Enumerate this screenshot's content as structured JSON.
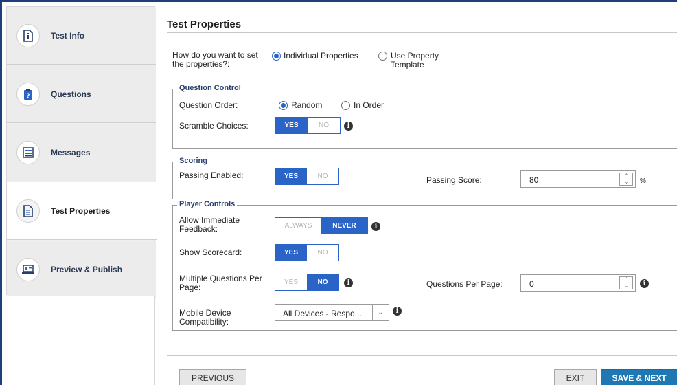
{
  "sidebar": {
    "items": [
      {
        "label": "Test Info",
        "icon": "document-info-icon"
      },
      {
        "label": "Questions",
        "icon": "clipboard-question-icon"
      },
      {
        "label": "Messages",
        "icon": "message-list-icon"
      },
      {
        "label": "Test Properties",
        "icon": "properties-list-icon"
      },
      {
        "label": "Preview & Publish",
        "icon": "laptop-preview-icon"
      }
    ],
    "active_index": 3
  },
  "main": {
    "title": "Test Properties",
    "set_properties": {
      "label_line1": "How do you want to set",
      "label_line2": "the properties?:",
      "options": [
        "Individual Properties",
        "Use Property",
        "Template"
      ],
      "selected": "Individual Properties"
    },
    "question_control": {
      "legend": "Question Control",
      "question_order_label": "Question Order:",
      "order_options": [
        "Random",
        "In Order"
      ],
      "order_selected": "Random",
      "scramble_label": "Scramble Choices:",
      "scramble_yes": "YES",
      "scramble_no": "NO",
      "scramble_value": "YES"
    },
    "scoring": {
      "legend": "Scoring",
      "passing_enabled_label": "Passing Enabled:",
      "yes": "YES",
      "no": "NO",
      "passing_enabled_value": "YES",
      "passing_score_label": "Passing Score:",
      "passing_score_value": "80",
      "passing_score_unit": "%"
    },
    "player_controls": {
      "legend": "Player Controls",
      "feedback_label_line1": "Allow Immediate",
      "feedback_label_line2": "Feedback:",
      "feedback_always": "ALWAYS",
      "feedback_never": "NEVER",
      "feedback_value": "NEVER",
      "scorecard_label": "Show Scorecard:",
      "scorecard_yes": "YES",
      "scorecard_no": "NO",
      "scorecard_value": "YES",
      "multi_label_line1": "Multiple Questions Per",
      "multi_label_line2": "Page:",
      "multi_yes": "YES",
      "multi_no": "NO",
      "multi_value": "NO",
      "qpp_label": "Questions Per Page:",
      "qpp_value": "0",
      "mobile_label_line1": "Mobile Device",
      "mobile_label_line2": "Compatibility:",
      "mobile_value": "All Devices - Respo..."
    }
  },
  "footer": {
    "previous": "PREVIOUS",
    "exit": "EXIT",
    "save_next": "SAVE & NEXT"
  },
  "colors": {
    "accent": "#2a64c7",
    "primary_button": "#1e78b4",
    "frame": "#1f3f7a"
  }
}
